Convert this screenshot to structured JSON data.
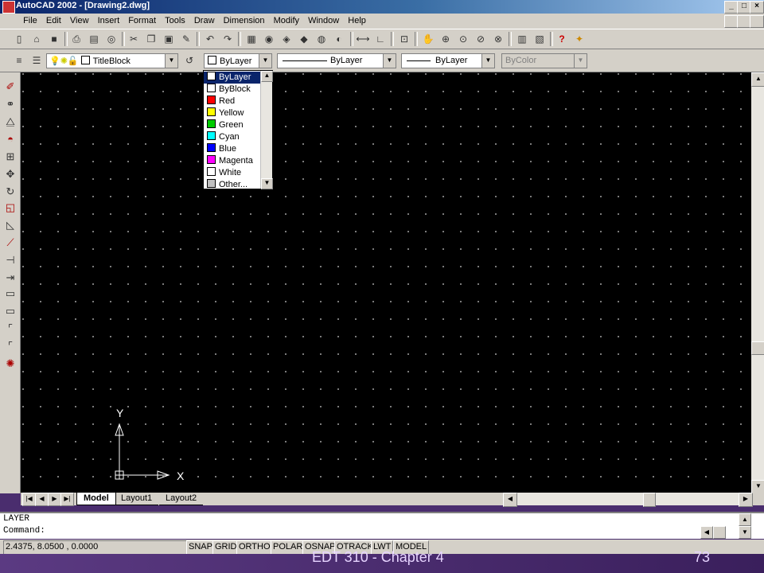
{
  "window": {
    "title": "AutoCAD 2002 - [Drawing2.dwg]",
    "min": "_",
    "max": "□",
    "close": "×"
  },
  "menus": [
    "File",
    "Edit",
    "View",
    "Insert",
    "Format",
    "Tools",
    "Draw",
    "Dimension",
    "Modify",
    "Window",
    "Help"
  ],
  "properties_toolbar": {
    "layer_name": "TitleBlock",
    "color_value": "ByLayer",
    "linetype_value": "ByLayer",
    "lineweight_value": "ByLayer",
    "plotstyle_value": "ByColor"
  },
  "color_dropdown": {
    "options": [
      {
        "label": "ByLayer",
        "color": "#ffffff",
        "selected": true
      },
      {
        "label": "ByBlock",
        "color": "#ffffff"
      },
      {
        "label": "Red",
        "color": "#ff0000"
      },
      {
        "label": "Yellow",
        "color": "#ffff00"
      },
      {
        "label": "Green",
        "color": "#00cc00"
      },
      {
        "label": "Cyan",
        "color": "#00ffff"
      },
      {
        "label": "Blue",
        "color": "#0000ff"
      },
      {
        "label": "Magenta",
        "color": "#ff00ff"
      },
      {
        "label": "White",
        "color": "#ffffff"
      },
      {
        "label": "Other...",
        "color": "#c0c0c0"
      }
    ]
  },
  "ucs": {
    "y_label": "Y",
    "x_label": "X"
  },
  "layout_tabs": {
    "tabs": [
      "Model",
      "Layout1",
      "Layout2"
    ],
    "active": "Model"
  },
  "command": {
    "history": "LAYER",
    "prompt": "Command:"
  },
  "status": {
    "coords": "2.4375, 8.0500 , 0.0000",
    "buttons": [
      "SNAP",
      "GRID",
      "ORTHO",
      "POLAR",
      "OSNAP",
      "OTRACK",
      "LWT",
      "MODEL"
    ]
  },
  "footer": {
    "left": "EDT 310 - Chapter 4",
    "right": "73"
  },
  "colors": {
    "canvas": "#000000",
    "grid": "#9a9a9a",
    "chrome": "#d4d0c8",
    "titlebar": "#0a246a",
    "selection": "#0a246a"
  }
}
